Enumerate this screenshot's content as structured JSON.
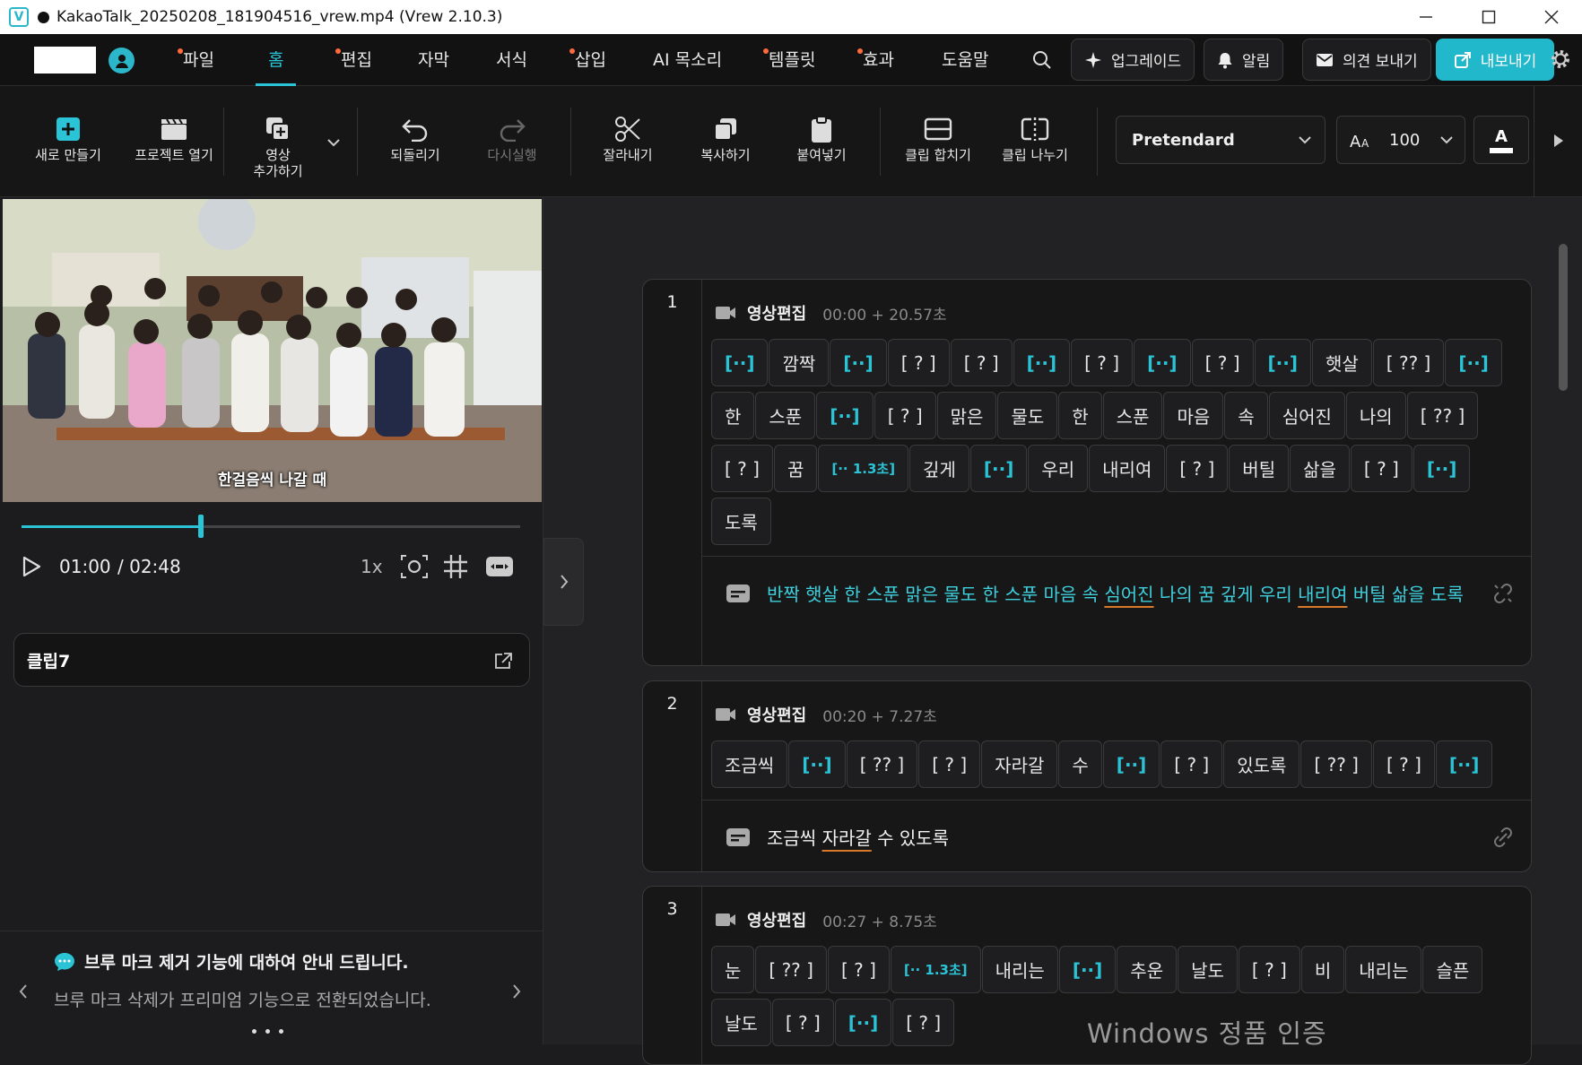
{
  "window": {
    "title": "KakaoTalk_20250208_181904516_vrew.mp4 (Vrew 2.10.3)",
    "app_icon": "V",
    "controls": [
      "minimize-icon",
      "maximize-icon",
      "close-icon"
    ]
  },
  "menubar": {
    "items": [
      {
        "label": "파일",
        "dot": true
      },
      {
        "label": "홈",
        "dot": false,
        "active": true
      },
      {
        "label": "편집",
        "dot": true
      },
      {
        "label": "자막",
        "dot": false
      },
      {
        "label": "서식",
        "dot": false
      },
      {
        "label": "삽입",
        "dot": true
      },
      {
        "label": "AI 목소리",
        "dot": false
      },
      {
        "label": "템플릿",
        "dot": true
      },
      {
        "label": "효과",
        "dot": true
      },
      {
        "label": "도움말",
        "dot": false
      }
    ],
    "upgrade_label": "업그레이드",
    "notify_label": "알림",
    "feedback_label": "의견 보내기",
    "export_label": "내보내기",
    "accent_color": "#22b8cc",
    "dot_color": "#ff6a3d"
  },
  "toolbar": {
    "new": "새로 만들기",
    "open": "프로젝트 열기",
    "add_video_1": "영상",
    "add_video_2": "추가하기",
    "undo": "되돌리기",
    "redo": "다시실행",
    "cut": "잘라내기",
    "copy": "복사하기",
    "paste": "붙여넣기",
    "merge": "클립 합치기",
    "split": "클립 나누기",
    "font": "Pretendard",
    "font_size": "100",
    "color_label": "A"
  },
  "player": {
    "caption": "한걸음씩 나갈 때",
    "progress": 0.36,
    "current_time": "01:00",
    "total_time": "/ 02:48",
    "speed": "1x"
  },
  "clip_panel": {
    "title": "클립7"
  },
  "notice": {
    "title": "브루 마크 제거 기능에 대하여 안내 드립니다.",
    "body": "브루 마크 삭제가 프리미엄 기능으로 전환되었습니다."
  },
  "clips": [
    {
      "number": "1",
      "type": "영상편집",
      "time": "00:00 + 20.57초",
      "words": [
        {
          "t": "[··]",
          "k": "sil"
        },
        {
          "t": "깜짝"
        },
        {
          "t": "[··]",
          "k": "sil"
        },
        {
          "t": "[ ? ]"
        },
        {
          "t": "[ ? ]"
        },
        {
          "t": "[··]",
          "k": "sil"
        },
        {
          "t": "[ ? ]"
        },
        {
          "t": "[··]",
          "k": "sil"
        },
        {
          "t": "[ ? ]"
        },
        {
          "t": "[··]",
          "k": "sil"
        },
        {
          "t": "햇살"
        },
        {
          "t": "[ ?? ]"
        },
        {
          "t": "[··]",
          "k": "sil"
        },
        {
          "t": "한"
        },
        {
          "t": "스푼"
        },
        {
          "t": "[··]",
          "k": "sil"
        },
        {
          "t": "[ ? ]"
        },
        {
          "t": "맑은"
        },
        {
          "t": "물도"
        },
        {
          "t": "한"
        },
        {
          "t": "스푼"
        },
        {
          "t": "마음"
        },
        {
          "t": "속"
        },
        {
          "t": "심어진"
        },
        {
          "t": "나의"
        },
        {
          "t": "[ ?? ]"
        },
        {
          "t": "[ ? ]"
        },
        {
          "t": "꿈"
        },
        {
          "t": "[·· 1.3초]",
          "k": "gap"
        },
        {
          "t": "깊게"
        },
        {
          "t": "[··]",
          "k": "sil"
        },
        {
          "t": "우리"
        },
        {
          "t": "내리여"
        },
        {
          "t": "[ ? ]"
        },
        {
          "t": "버틸"
        },
        {
          "t": "삶을"
        },
        {
          "t": "[ ? ]"
        },
        {
          "t": "[··]",
          "k": "sil"
        },
        {
          "t": "도록"
        }
      ],
      "subtitle_parts": [
        {
          "t": "반짝 햇살 한 스푼 맑은 물도 한 스푼 마음 속 "
        },
        {
          "t": "심어진",
          "u": true
        },
        {
          "t": " 나의 꿈 깊게 우리 "
        },
        {
          "t": "내리여",
          "u": true
        },
        {
          "t": " 버틸 삶을 도록"
        }
      ],
      "subtitle_color": "#3fd0de"
    },
    {
      "number": "2",
      "type": "영상편집",
      "time": "00:20 + 7.27초",
      "words": [
        {
          "t": "조금씩"
        },
        {
          "t": "[··]",
          "k": "sil"
        },
        {
          "t": "[ ?? ]"
        },
        {
          "t": "[ ? ]"
        },
        {
          "t": "자라갈"
        },
        {
          "t": "수"
        },
        {
          "t": "[··]",
          "k": "sil"
        },
        {
          "t": "[ ? ]"
        },
        {
          "t": "있도록"
        },
        {
          "t": "[ ?? ]"
        },
        {
          "t": "[ ? ]"
        },
        {
          "t": "[··]",
          "k": "sil"
        }
      ],
      "subtitle_parts": [
        {
          "t": "조금씩 "
        },
        {
          "t": "자라갈",
          "u": true
        },
        {
          "t": " 수 있도록"
        }
      ],
      "subtitle_color": "#f2f2f2"
    },
    {
      "number": "3",
      "type": "영상편집",
      "time": "00:27 + 8.75초",
      "words": [
        {
          "t": "눈"
        },
        {
          "t": "[ ?? ]"
        },
        {
          "t": "[ ? ]"
        },
        {
          "t": "[·· 1.3초]",
          "k": "gap"
        },
        {
          "t": "내리는"
        },
        {
          "t": "[··]",
          "k": "sil"
        },
        {
          "t": "추운"
        },
        {
          "t": "날도"
        },
        {
          "t": "[ ? ]"
        },
        {
          "t": "비"
        },
        {
          "t": "내리는"
        },
        {
          "t": "슬픈"
        },
        {
          "t": "날도"
        },
        {
          "t": "[ ? ]"
        },
        {
          "t": "[··]",
          "k": "sil"
        },
        {
          "t": "[ ? ]"
        }
      ]
    }
  ],
  "watermark": "Windows 정품 인증"
}
